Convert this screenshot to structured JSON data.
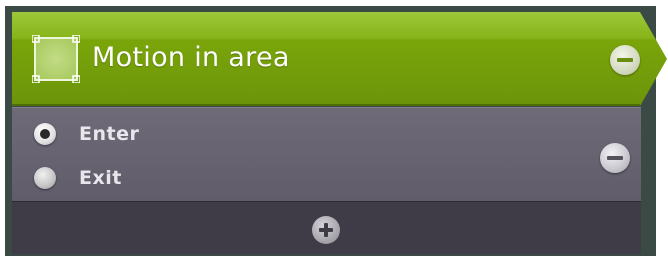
{
  "block": {
    "title": "Motion in area",
    "icon": "area-selection-icon",
    "header_color": "#7aa50a",
    "collapse_icon": "minus-circle-icon"
  },
  "options": {
    "items": [
      {
        "label": "Enter",
        "selected": true
      },
      {
        "label": "Exit",
        "selected": false
      }
    ],
    "collapse_icon": "minus-circle-icon",
    "background_color": "#666270"
  },
  "footer": {
    "add_icon": "plus-circle-icon",
    "background_color": "#3f3c47"
  }
}
